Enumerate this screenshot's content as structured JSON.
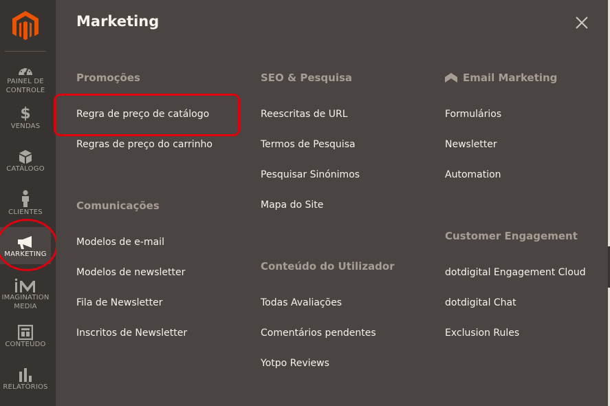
{
  "sidebar": {
    "logo": "magento-logo",
    "items": [
      {
        "label_line1": "PAINEL DE",
        "label_line2": "CONTROLE",
        "icon": "dashboard-icon"
      },
      {
        "label_line1": "VENDAS",
        "label_line2": "",
        "icon": "dollar-icon"
      },
      {
        "label_line1": "CATÁLOGO",
        "label_line2": "",
        "icon": "box-icon"
      },
      {
        "label_line1": "CLIENTES",
        "label_line2": "",
        "icon": "person-icon"
      },
      {
        "label_line1": "MARKETING",
        "label_line2": "",
        "icon": "megaphone-icon",
        "active": true
      },
      {
        "label_line1": "IMAGINATION",
        "label_line2": "MEDIA",
        "icon": "im-logo-icon"
      },
      {
        "label_line1": "CONTEÚDO",
        "label_line2": "",
        "icon": "layout-icon"
      },
      {
        "label_line1": "RELATÓRIOS",
        "label_line2": "",
        "icon": "bar-chart-icon"
      }
    ]
  },
  "panel": {
    "title": "Marketing",
    "close_icon": "close-icon",
    "columns": [
      {
        "sections": [
          {
            "title": "Promoções",
            "links": [
              "Regra de preço de catálogo",
              "Regras de preço do carrinho"
            ]
          },
          {
            "title": "Comunicações",
            "links": [
              "Modelos de e-mail",
              "Modelos de newsletter",
              "Fila de Newsletter",
              "Inscritos de Newsletter"
            ]
          }
        ]
      },
      {
        "sections": [
          {
            "title": "SEO & Pesquisa",
            "links": [
              "Reescritas de URL",
              "Termos de Pesquisa",
              "Pesquisar Sinónimos",
              "Mapa do Site"
            ]
          },
          {
            "title": "Conteúdo do Utilizador",
            "links": [
              "Todas Avaliações",
              "Comentários pendentes",
              "Yotpo Reviews"
            ]
          }
        ]
      },
      {
        "sections": [
          {
            "title": "Email Marketing",
            "icon": "dotdigital-icon",
            "links": [
              "Formulários",
              "Newsletter",
              "Automation"
            ]
          },
          {
            "title": "Customer Engagement",
            "links": [
              "dotdigital Engagement Cloud",
              "dotdigital Chat",
              "Exclusion Rules"
            ]
          }
        ]
      }
    ]
  },
  "colors": {
    "sidebar_bg": "#373330",
    "panel_bg": "#4a4542",
    "logo_orange": "#eb5202",
    "section_title": "#a79d95",
    "link_text": "#f7f3eb",
    "annotation_red": "#e0000d"
  }
}
